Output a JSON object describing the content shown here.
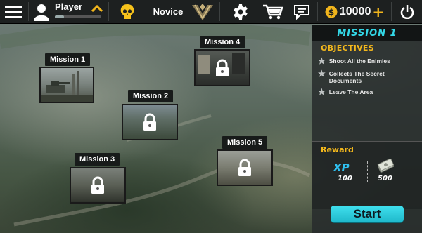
{
  "topbar": {
    "player_label": "Player",
    "rank_label": "Novice",
    "coins": "10000",
    "plus": "+",
    "xp_progress": 0.2,
    "icons": [
      "menu-icon",
      "avatar-icon",
      "chevron-up-icon",
      "skull-icon",
      "rank-emblem-icon",
      "gear-icon",
      "cart-icon",
      "chat-icon",
      "coin-icon",
      "power-icon"
    ]
  },
  "missions": [
    {
      "label": "Mission 1",
      "locked": false
    },
    {
      "label": "Mission 2",
      "locked": true
    },
    {
      "label": "Mission 3",
      "locked": true
    },
    {
      "label": "Mission 4",
      "locked": true
    },
    {
      "label": "Mission 5",
      "locked": true
    }
  ],
  "panel": {
    "title": "MISSION 1",
    "objectives_heading": "OBJECTIVES",
    "objectives": [
      "Shoot All the Enimies",
      "Collects The Secret Documents",
      "Leave The Area"
    ],
    "reward_heading": "Reward",
    "xp_label": "XP",
    "xp_value": "100",
    "cash_value": "500"
  },
  "start_label": "Start",
  "colors": {
    "accent_cyan": "#33d7e6",
    "accent_gold": "#f4b81c",
    "xp_blue": "#2fc0f0",
    "topbar": "#1d2020"
  }
}
